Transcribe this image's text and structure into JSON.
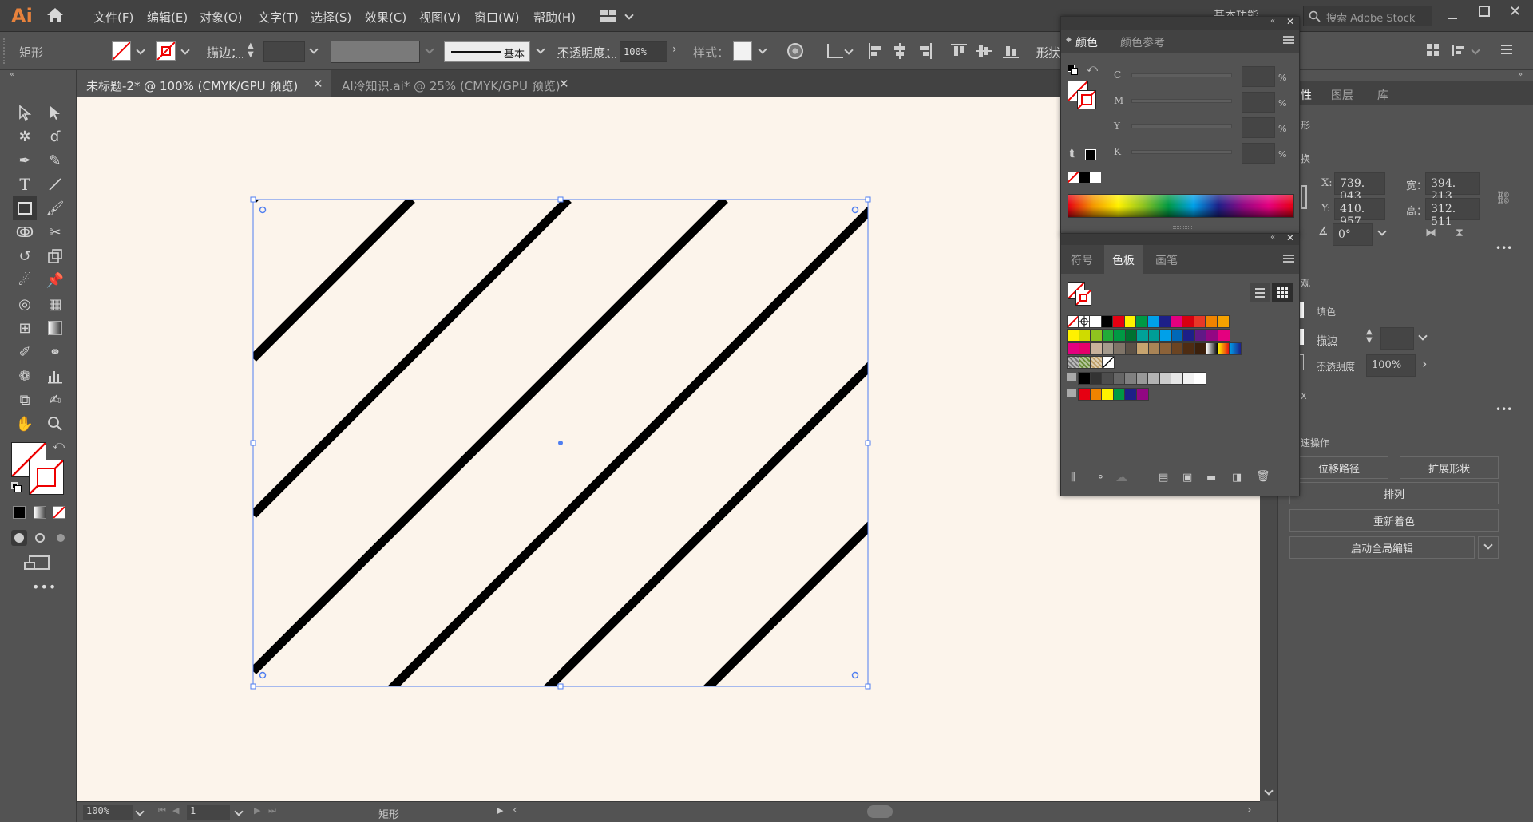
{
  "app": {
    "logo": "Ai"
  },
  "menu": [
    "文件(F)",
    "编辑(E)",
    "对象(O)",
    "文字(T)",
    "选择(S)",
    "效果(C)",
    "视图(V)",
    "窗口(W)",
    "帮助(H)"
  ],
  "workspace": {
    "label": "基本功能",
    "search_placeholder": "搜索 Adobe Stock"
  },
  "control": {
    "object_type": "矩形",
    "stroke_label": "描边：",
    "stroke_style": "基本",
    "opacity_label": "不透明度：",
    "opacity_value": "100%",
    "style_label": "样式：",
    "shape_label": "形状"
  },
  "tabs": [
    {
      "title": "未标题-2* @ 100% (CMYK/GPU 预览)",
      "close": "✕"
    },
    {
      "title": "AI冷知识.ai* @ 25% (CMYK/GPU 预览)",
      "close": "✕"
    }
  ],
  "color_panel": {
    "tabs": [
      "颜色",
      "颜色参考"
    ],
    "channels": [
      "C",
      "M",
      "Y",
      "K"
    ],
    "pct": "%"
  },
  "swatch_panel": {
    "tabs": [
      "符号",
      "色板",
      "画笔"
    ]
  },
  "properties": {
    "tabs": [
      "性",
      "图层",
      "库"
    ],
    "section_shape": "形",
    "section_transform": "换",
    "x_label": "X:",
    "x_value": "739. 043",
    "y_label": "Y:",
    "y_value": "410. 957",
    "w_label": "宽：",
    "w_value": "394. 213",
    "h_label": "高：",
    "h_value": "312. 511",
    "angle_value": "0°",
    "section_appearance": "观",
    "fill_label": "填色",
    "stroke_label": "描边",
    "opacity_label": "不透明度",
    "opacity_value": "100%",
    "section_quick": "速操作",
    "btn_offset": "位移路径",
    "btn_expand": "扩展形状",
    "btn_arrange": "排列",
    "btn_recolor": "重新着色",
    "btn_global_edit": "启动全局编辑",
    "section_x": "X"
  },
  "status": {
    "zoom": "100%",
    "page": "1",
    "tool": "矩形"
  },
  "colors": {
    "swatches_row1": [
      "#ffffff",
      "#000000",
      "#e60012",
      "#fff100",
      "#009944",
      "#00a0e9",
      "#1d2088",
      "#e4007f",
      "#d7000f",
      "#e83828",
      "#f08300",
      "#f5a200"
    ],
    "swatches_row2": [
      "#fff100",
      "#cfdb00",
      "#8fc31f",
      "#22ac38",
      "#009944",
      "#007130",
      "#00a199",
      "#009e96",
      "#00a0e9",
      "#0068b7",
      "#1d2088",
      "#601986",
      "#920783",
      "#e4007f"
    ],
    "swatches_row3": [
      "#e4007f",
      "#e5006a",
      "#c9b29c",
      "#a59b8d",
      "#7f7468",
      "#5b5147",
      "#c7a46f",
      "#a98456",
      "#8b6239",
      "#6b4422",
      "#4e2c12",
      "#3b200c"
    ],
    "swatches_gray": [
      "#000000",
      "#333333",
      "#4d4d4d",
      "#666666",
      "#808080",
      "#999999",
      "#b3b3b3",
      "#cccccc",
      "#e6e6e6",
      "#f2f2f2",
      "#ffffff"
    ],
    "swatches_bright": [
      "#e60012",
      "#f08300",
      "#fff100",
      "#009944",
      "#1d2088",
      "#920783"
    ]
  }
}
